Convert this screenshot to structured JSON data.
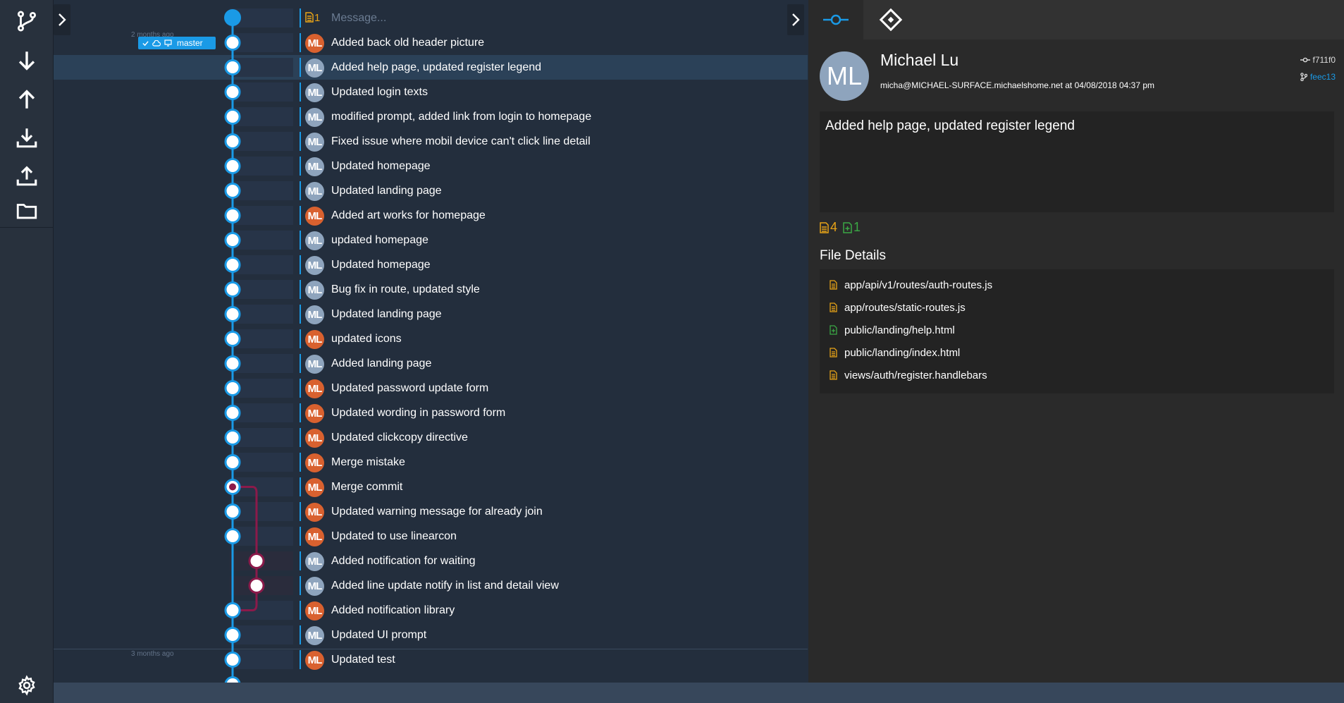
{
  "toolbar": {
    "items": [
      {
        "name": "branch-icon"
      },
      {
        "name": "pull-icon"
      },
      {
        "name": "push-icon"
      },
      {
        "name": "fetch-icon"
      },
      {
        "name": "upload-icon"
      },
      {
        "name": "folder-icon"
      }
    ],
    "settings": "gear-icon"
  },
  "graph": {
    "message_placeholder": "Message...",
    "new_file_count": "1",
    "branch_badge": "master",
    "date_labels": [
      "2 months ago",
      "3 months ago"
    ],
    "commits": [
      {
        "initials": "ML",
        "color": "orange",
        "message": "Added back old header picture"
      },
      {
        "initials": "ML",
        "color": "gray",
        "message": "Added help page, updated register legend",
        "selected": true
      },
      {
        "initials": "ML",
        "color": "gray",
        "message": "Updated login texts"
      },
      {
        "initials": "ML",
        "color": "gray",
        "message": "modified prompt, added link from login to homepage"
      },
      {
        "initials": "ML",
        "color": "gray",
        "message": "Fixed issue where mobil device can't click line detail"
      },
      {
        "initials": "ML",
        "color": "gray",
        "message": "Updated homepage"
      },
      {
        "initials": "ML",
        "color": "gray",
        "message": "Updated landing page"
      },
      {
        "initials": "ML",
        "color": "orange",
        "message": "Added art works for homepage"
      },
      {
        "initials": "ML",
        "color": "gray",
        "message": "updated homepage"
      },
      {
        "initials": "ML",
        "color": "gray",
        "message": "Updated homepage"
      },
      {
        "initials": "ML",
        "color": "gray",
        "message": "Bug fix in route, updated style"
      },
      {
        "initials": "ML",
        "color": "gray",
        "message": "Updated landing page"
      },
      {
        "initials": "ML",
        "color": "orange",
        "message": "updated icons"
      },
      {
        "initials": "ML",
        "color": "gray",
        "message": "Added landing page"
      },
      {
        "initials": "ML",
        "color": "orange",
        "message": "Updated password update form"
      },
      {
        "initials": "ML",
        "color": "orange",
        "message": "Updated wording in password form"
      },
      {
        "initials": "ML",
        "color": "orange",
        "message": "Updated clickcopy directive"
      },
      {
        "initials": "ML",
        "color": "orange",
        "message": "Merge mistake"
      },
      {
        "initials": "ML",
        "color": "orange",
        "message": "Merge commit",
        "merge": true
      },
      {
        "initials": "ML",
        "color": "orange",
        "message": "Updated warning message for already join"
      },
      {
        "initials": "ML",
        "color": "orange",
        "message": "Updated to use linearcon"
      },
      {
        "initials": "ML",
        "color": "gray",
        "message": "Added notification for waiting",
        "branch": true
      },
      {
        "initials": "ML",
        "color": "gray",
        "message": "Added line update notify in list and detail view",
        "branch": true
      },
      {
        "initials": "ML",
        "color": "orange",
        "message": "Added notification library"
      },
      {
        "initials": "ML",
        "color": "gray",
        "message": "Updated UI prompt"
      },
      {
        "initials": "ML",
        "color": "orange",
        "message": "Updated test"
      }
    ]
  },
  "detail": {
    "author_initials": "ML",
    "author_name": "Michael Lu",
    "author_email": "micha@MICHAEL-SURFACE.michaelshome.net  at  04/08/2018 04:37 pm",
    "commit_hash": "f711f0",
    "parent_hash": "feec13",
    "commit_message": "Added help page, updated register legend",
    "modified_count": "4",
    "added_count": "1",
    "file_details_title": "File Details",
    "files": [
      {
        "path": "app/api/v1/routes/auth-routes.js",
        "status": "modified"
      },
      {
        "path": "app/routes/static-routes.js",
        "status": "modified"
      },
      {
        "path": "public/landing/help.html",
        "status": "added"
      },
      {
        "path": "public/landing/index.html",
        "status": "modified"
      },
      {
        "path": "views/auth/register.handlebars",
        "status": "modified"
      }
    ]
  },
  "colors": {
    "accent": "#1a9ae6",
    "merge": "#8b1a4a",
    "modified": "#e8a317",
    "added": "#3aa845",
    "avatar_orange": "#d9612f",
    "avatar_gray": "#8ea4bd"
  }
}
